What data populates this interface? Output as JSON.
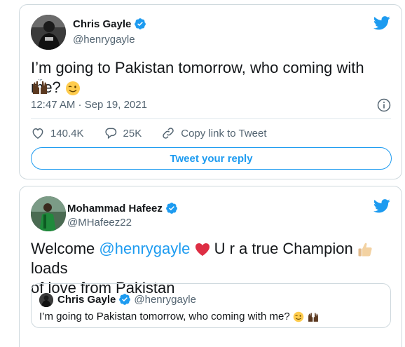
{
  "tweet": {
    "author_name": "Chris Gayle",
    "author_handle": "@henrygayle",
    "text": "I’m going to Pakistan tomorrow, who coming with me?",
    "timestamp": "12:47 AM · Sep 19, 2021",
    "likes": "140.4K",
    "replies": "25K",
    "copy_link_label": "Copy link to Tweet",
    "reply_button_label": "Tweet your reply"
  },
  "reply_tweet": {
    "author_name": "Mohammad Hafeez",
    "author_handle": "@MHafeez22",
    "text_prefix": "Welcome ",
    "mention": "@henrygayle",
    "text_middle": " U r a true Champion ",
    "text_suffix": " loads",
    "text_line2": "of love from Pakistan",
    "quoted": {
      "author_name": "Chris Gayle",
      "author_handle": "@henrygayle",
      "text": "I’m going to Pakistan tomorrow, who coming with me?"
    }
  },
  "colors": {
    "accent": "#1d9bf0",
    "secondary_text": "#536471",
    "heart": "#e0245e"
  },
  "icons": [
    "verified-badge-icon",
    "twitter-bird-icon",
    "info-icon",
    "heart-icon",
    "reply-icon",
    "link-icon",
    "wink-emoji-icon",
    "raised-hands-emoji-icon",
    "red-heart-emoji-icon",
    "thumbs-up-emoji-icon"
  ]
}
